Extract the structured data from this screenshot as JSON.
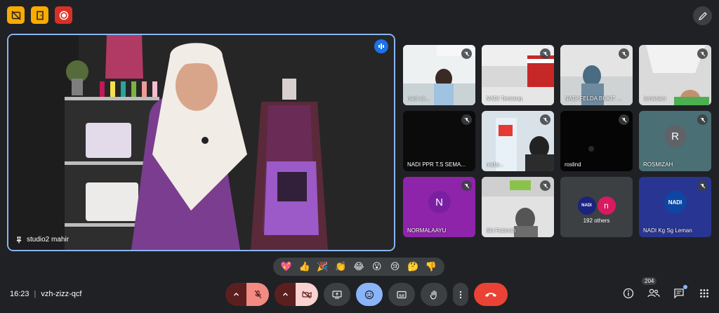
{
  "top_icons": [
    {
      "icon": "captions-off-icon",
      "color": "#f9ab00"
    },
    {
      "icon": "door-icon",
      "color": "#f9ab00"
    },
    {
      "icon": "record-icon",
      "color": "#d93025"
    }
  ],
  "main_speaker": {
    "name": "studio2 mahir"
  },
  "participants": [
    {
      "name": "nadi sir...",
      "muted": true
    },
    {
      "name": "NADI Temiang",
      "muted": true
    },
    {
      "name": "NADI FELDA BUKIT ...",
      "muted": true
    },
    {
      "name": "Ismahani",
      "muted": true
    },
    {
      "name": "NADI PPR T.S SEMA...",
      "muted": true
    },
    {
      "name": "nadiy...",
      "muted": true
    },
    {
      "name": "roslind",
      "muted": true
    },
    {
      "name": "ROSMIZAH",
      "muted": true,
      "initial": "R",
      "avatar_color": "#5f6368"
    },
    {
      "name": "NORMALAAYU",
      "muted": true,
      "initial": "N",
      "avatar_color": "#7b1fa2"
    },
    {
      "name": "Siti Fatimah",
      "muted": true
    },
    {
      "name": "192 others",
      "others": true,
      "initials": [
        "NADI",
        "n"
      ]
    },
    {
      "name": "NADI Kg Sg Leman",
      "muted": true,
      "logo": "NADI"
    }
  ],
  "reactions": [
    "💖",
    "👍",
    "🎉",
    "👏",
    "😂",
    "😮",
    "😢",
    "🤔",
    "👎"
  ],
  "meeting": {
    "time": "16:23",
    "separator": "|",
    "code": "vzh-zizz-qcf"
  },
  "people_count": "204",
  "colors": {
    "accent": "#8ab4f8",
    "end_call": "#ea4335",
    "muted_red": "#f28b82"
  }
}
